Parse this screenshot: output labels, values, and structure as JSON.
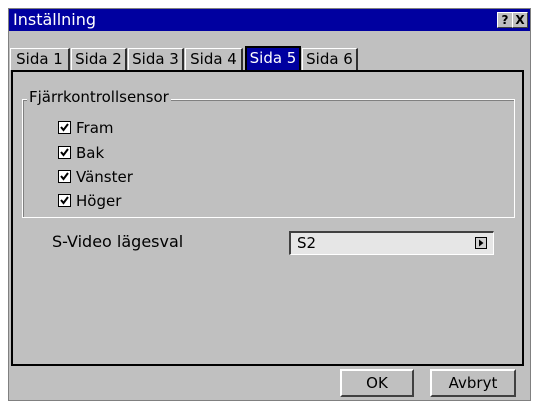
{
  "window": {
    "title": "Inställning",
    "help_glyph": "?",
    "close_glyph": "X"
  },
  "tabs": [
    {
      "label": "Sida 1",
      "selected": false
    },
    {
      "label": "Sida 2",
      "selected": false
    },
    {
      "label": "Sida 3",
      "selected": false
    },
    {
      "label": "Sida 4",
      "selected": false
    },
    {
      "label": "Sida 5",
      "selected": true
    },
    {
      "label": "Sida 6",
      "selected": false
    }
  ],
  "remote_sensor": {
    "title": "Fjärrkontrollsensor",
    "options": [
      {
        "label": "Fram",
        "checked": true
      },
      {
        "label": "Bak",
        "checked": true
      },
      {
        "label": "Vänster",
        "checked": true
      },
      {
        "label": "Höger",
        "checked": true
      }
    ]
  },
  "svideo": {
    "label": "S-Video lägesval",
    "value": "S2"
  },
  "buttons": {
    "ok": "OK",
    "cancel": "Avbryt"
  },
  "colors": {
    "titlebar": "#0000a0",
    "face": "#c0c0c0",
    "field": "#e6e6e6"
  }
}
